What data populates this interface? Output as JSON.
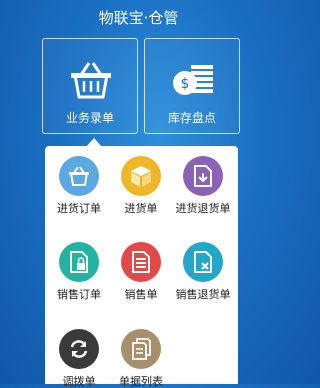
{
  "header": {
    "title": "物联宝·仓管"
  },
  "modules": [
    {
      "label": "业务录单",
      "icon": "basket-icon"
    },
    {
      "label": "库存盘点",
      "icon": "inventory-coins-icon"
    }
  ],
  "operations": [
    {
      "label": "进货订单",
      "icon": "basket-icon",
      "color": "#5ba9e0"
    },
    {
      "label": "进货单",
      "icon": "box-icon",
      "color": "#f0b62a"
    },
    {
      "label": "进货退货单",
      "icon": "return-document-icon",
      "color": "#8a63b8"
    },
    {
      "label": "销售订单",
      "icon": "locked-document-icon",
      "color": "#22b3a1"
    },
    {
      "label": "销售单",
      "icon": "document-icon",
      "color": "#e24a4a"
    },
    {
      "label": "销售退货单",
      "icon": "cancel-document-icon",
      "color": "#23a7c8"
    },
    {
      "label": "调拨单",
      "icon": "transfer-arrows-icon",
      "color": "#3a3a3a"
    },
    {
      "label": "单据列表",
      "icon": "documents-list-icon",
      "color": "#a88f6c"
    }
  ]
}
